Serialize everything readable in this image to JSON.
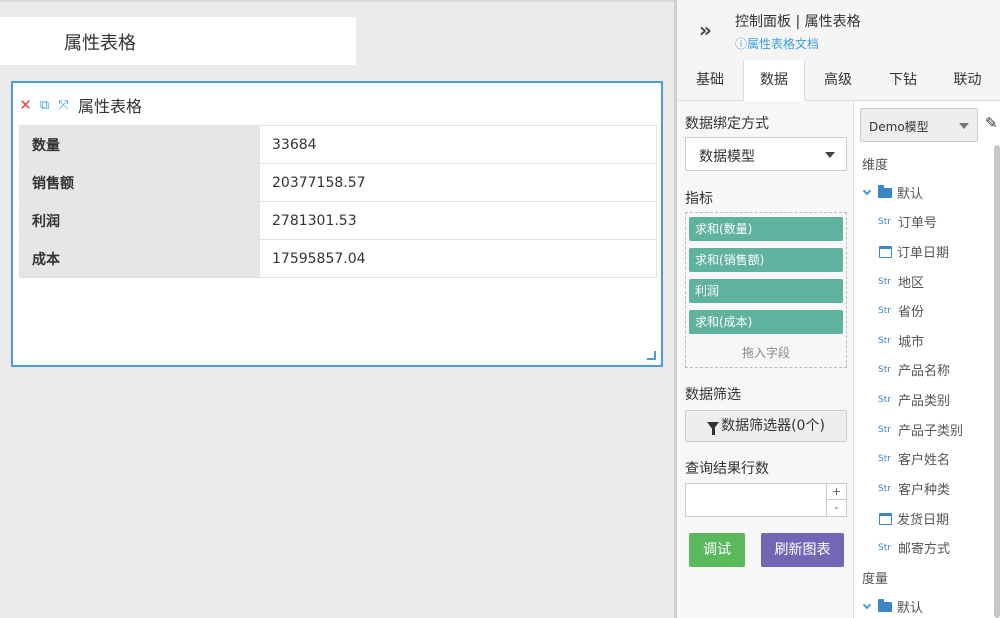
{
  "canvas": {
    "page_title": "属性表格",
    "widget": {
      "title": "属性表格",
      "rows": [
        {
          "label": "数量",
          "value": "33684"
        },
        {
          "label": "销售额",
          "value": "20377158.57"
        },
        {
          "label": "利润",
          "value": "2781301.53"
        },
        {
          "label": "成本",
          "value": "17595857.04"
        }
      ]
    }
  },
  "panel": {
    "title": "控制面板 | 属性表格",
    "doc_link": "属性表格文档",
    "tabs": [
      "基础",
      "数据",
      "高级",
      "下钻",
      "联动"
    ],
    "active_tab": "数据",
    "binding_label": "数据绑定方式",
    "binding_value": "数据模型",
    "metrics_label": "指标",
    "metrics": [
      "求和(数量)",
      "求和(销售额)",
      "利润",
      "求和(成本)"
    ],
    "drop_hint": "拖入字段",
    "filter_label": "数据筛选",
    "filter_button": "数据筛选器(0个)",
    "rows_label": "查询结果行数",
    "rows_value": "",
    "spin_up": "+",
    "spin_down": "-",
    "debug_button": "调试",
    "refresh_button": "刷新图表",
    "model_select": "Demo模型",
    "dimension_label": "维度",
    "dimension_group": "默认",
    "dimension_fields": [
      {
        "type": "Str",
        "name": "订单号"
      },
      {
        "type": "date",
        "name": "订单日期"
      },
      {
        "type": "Str",
        "name": "地区"
      },
      {
        "type": "Str",
        "name": "省份"
      },
      {
        "type": "Str",
        "name": "城市"
      },
      {
        "type": "Str",
        "name": "产品名称"
      },
      {
        "type": "Str",
        "name": "产品类别"
      },
      {
        "type": "Str",
        "name": "产品子类别"
      },
      {
        "type": "Str",
        "name": "客户姓名"
      },
      {
        "type": "Str",
        "name": "客户种类"
      },
      {
        "type": "date",
        "name": "发货日期"
      },
      {
        "type": "Str",
        "name": "邮寄方式"
      }
    ],
    "measure_label": "度量",
    "measure_group": "默认"
  }
}
